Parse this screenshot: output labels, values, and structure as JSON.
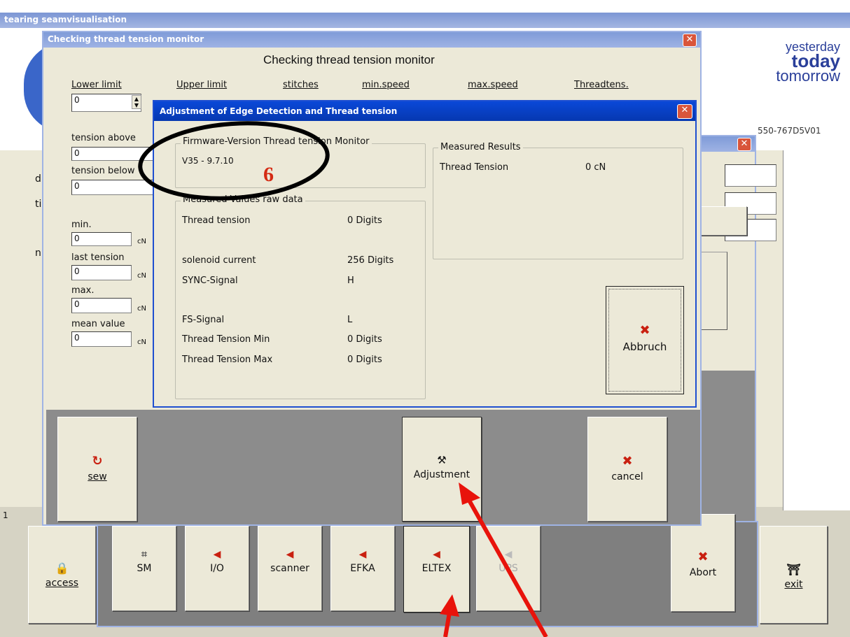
{
  "main_window": {
    "title": "tearing seamvisualisation",
    "logo": {
      "line1": "yesterday",
      "line2": "today",
      "line3": "tomorrow"
    },
    "code": "550-767D5V01",
    "left_letters": [
      "d",
      "ti",
      "n"
    ],
    "partial_button": "s",
    "status_number": "1",
    "bottom_buttons": [
      {
        "label": "access",
        "icon": "lock-icon"
      },
      {
        "label": "SM",
        "icon": "sm-icon"
      },
      {
        "label": "I/O",
        "icon": "arrow-left-icon"
      },
      {
        "label": "scanner",
        "icon": "arrow-left-icon"
      },
      {
        "label": "EFKA",
        "icon": "arrow-left-icon"
      },
      {
        "label": "ELTEX",
        "icon": "arrow-left-icon"
      },
      {
        "label": "UPS",
        "icon": "arrow-left-icon"
      },
      {
        "label": "Abort",
        "icon": "x-icon"
      },
      {
        "label": "exit",
        "icon": "exit-icon"
      }
    ]
  },
  "checking_window": {
    "title": "Checking thread tension monitor",
    "heading": "Checking thread tension monitor",
    "columns": [
      "Lower limit",
      "Upper limit",
      "stitches",
      "min.speed",
      "max.speed",
      "Threadtens."
    ],
    "lower_limit_value": "0",
    "tension_above_label": "tension above",
    "tension_above_value": "0",
    "tension_below_label": "tension below",
    "tension_below_value": "0",
    "min_label": "min.",
    "min_value": "0",
    "last_tension_label": "last tension",
    "last_tension_value": "0",
    "max_label": "max.",
    "max_value": "0",
    "mean_label": "mean value",
    "mean_value": "0",
    "unit": "cN",
    "buttons": {
      "sew": "sew",
      "adjustment": "Adjustment",
      "cancel": "cancel"
    }
  },
  "adjust_dialog": {
    "title": "Adjustment of Edge Detection and Thread tension",
    "firmware_group": "Firmware-Version Thread tension Monitor",
    "firmware_value": "V35 - 9.7.10",
    "annotation_number": "6",
    "raw_group": "Measured Values raw data",
    "raw_rows": [
      {
        "label": "Thread tension",
        "value": "0 Digits"
      },
      {
        "label": "solenoid current",
        "value": "256 Digits"
      },
      {
        "label": "SYNC-Signal",
        "value": "H"
      },
      {
        "label": "FS-Signal",
        "value": "L"
      },
      {
        "label": "Thread Tension Min",
        "value": "0 Digits"
      },
      {
        "label": "Thread Tension Max",
        "value": "0 Digits"
      }
    ],
    "results_group": "Measured Results",
    "result_label": "Thread Tension",
    "result_value": "0 cN",
    "abort_label": "Abbruch"
  },
  "colors": {
    "dialog_face": "#ece9d8",
    "title_bar": "#0a3fb8",
    "annotation": "#d42b14",
    "arrow": "#e8130b"
  }
}
